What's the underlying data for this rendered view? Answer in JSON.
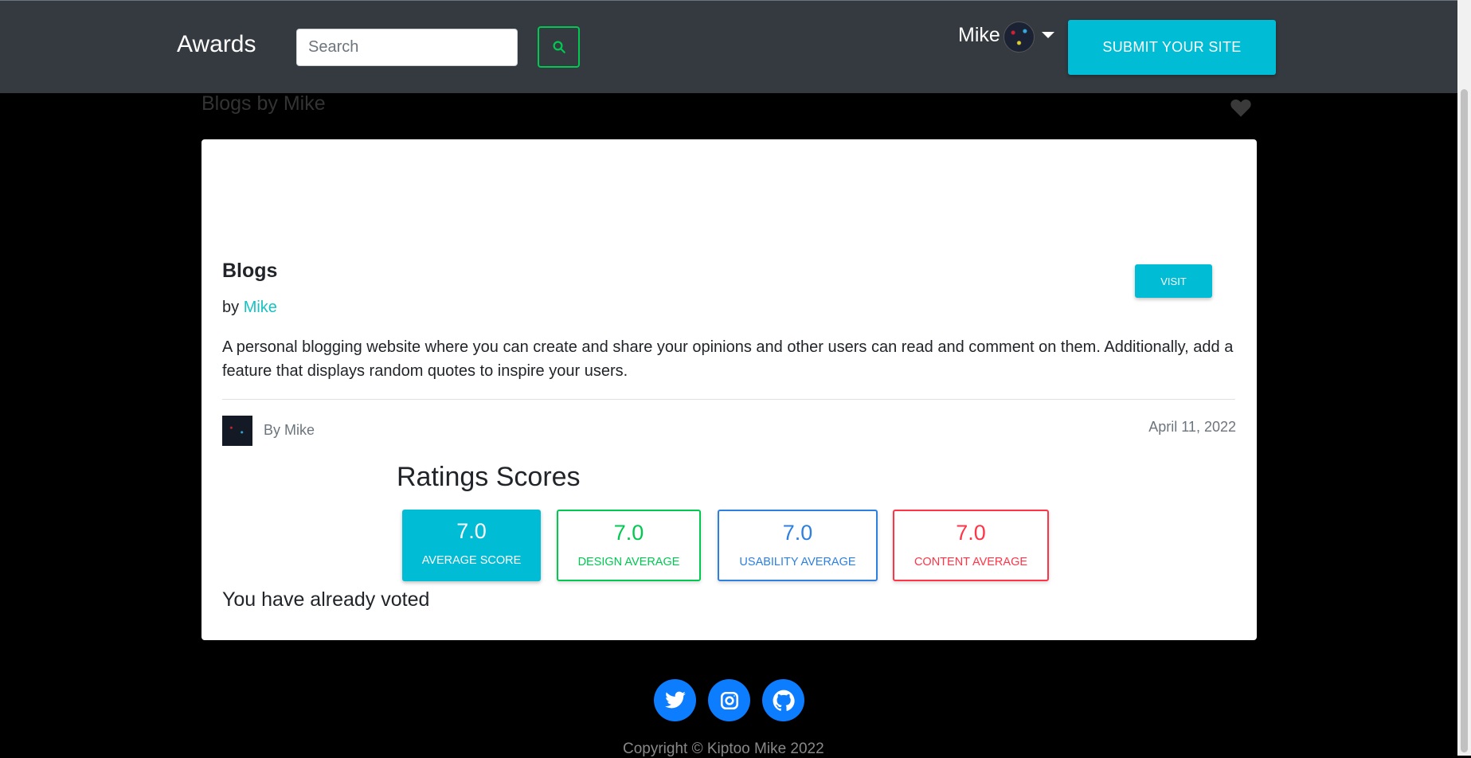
{
  "navbar": {
    "brand": "Awards",
    "search_placeholder": "Search",
    "user_name": "Mike",
    "submit_label": "SUBMIT YOUR SITE"
  },
  "page": {
    "heading": "Blogs by Mike"
  },
  "project": {
    "title": "Blogs",
    "by_prefix": "by",
    "author_link": "Mike",
    "visit_label": "VISIT",
    "description": "A personal blogging website where you can create and share your opinions and other users can read and comment on them. Additionally, add a feature that displays random quotes to inspire your users.",
    "posted_by": "By Mike",
    "date": "April 11, 2022"
  },
  "ratings": {
    "title": "Ratings Scores",
    "average": {
      "value": "7.0",
      "label": "AVERAGE SCORE"
    },
    "design": {
      "value": "7.0",
      "label": "DESIGN AVERAGE"
    },
    "usability": {
      "value": "7.0",
      "label": "USABILITY AVERAGE"
    },
    "content": {
      "value": "7.0",
      "label": "CONTENT AVERAGE"
    },
    "voted_message": "You have already voted"
  },
  "footer": {
    "copyright": "Copyright © Kiptoo Mike 2022",
    "social_icons": [
      "twitter-icon",
      "instagram-icon",
      "github-icon"
    ]
  },
  "colors": {
    "navbar_bg": "#343a40",
    "accent_cyan": "#00bcd4",
    "success_green": "#00c851",
    "primary_blue": "#2d7fe0",
    "danger_red": "#ff3547",
    "social_blue": "#0d7dff"
  }
}
